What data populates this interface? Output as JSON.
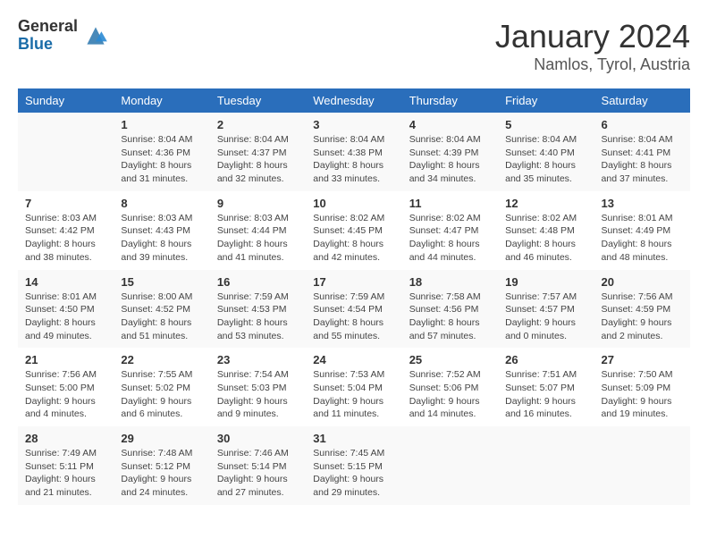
{
  "logo": {
    "general": "General",
    "blue": "Blue"
  },
  "title": "January 2024",
  "subtitle": "Namlos, Tyrol, Austria",
  "days_header": [
    "Sunday",
    "Monday",
    "Tuesday",
    "Wednesday",
    "Thursday",
    "Friday",
    "Saturday"
  ],
  "weeks": [
    [
      {
        "day": "",
        "info": ""
      },
      {
        "day": "1",
        "info": "Sunrise: 8:04 AM\nSunset: 4:36 PM\nDaylight: 8 hours\nand 31 minutes."
      },
      {
        "day": "2",
        "info": "Sunrise: 8:04 AM\nSunset: 4:37 PM\nDaylight: 8 hours\nand 32 minutes."
      },
      {
        "day": "3",
        "info": "Sunrise: 8:04 AM\nSunset: 4:38 PM\nDaylight: 8 hours\nand 33 minutes."
      },
      {
        "day": "4",
        "info": "Sunrise: 8:04 AM\nSunset: 4:39 PM\nDaylight: 8 hours\nand 34 minutes."
      },
      {
        "day": "5",
        "info": "Sunrise: 8:04 AM\nSunset: 4:40 PM\nDaylight: 8 hours\nand 35 minutes."
      },
      {
        "day": "6",
        "info": "Sunrise: 8:04 AM\nSunset: 4:41 PM\nDaylight: 8 hours\nand 37 minutes."
      }
    ],
    [
      {
        "day": "7",
        "info": "Sunrise: 8:03 AM\nSunset: 4:42 PM\nDaylight: 8 hours\nand 38 minutes."
      },
      {
        "day": "8",
        "info": "Sunrise: 8:03 AM\nSunset: 4:43 PM\nDaylight: 8 hours\nand 39 minutes."
      },
      {
        "day": "9",
        "info": "Sunrise: 8:03 AM\nSunset: 4:44 PM\nDaylight: 8 hours\nand 41 minutes."
      },
      {
        "day": "10",
        "info": "Sunrise: 8:02 AM\nSunset: 4:45 PM\nDaylight: 8 hours\nand 42 minutes."
      },
      {
        "day": "11",
        "info": "Sunrise: 8:02 AM\nSunset: 4:47 PM\nDaylight: 8 hours\nand 44 minutes."
      },
      {
        "day": "12",
        "info": "Sunrise: 8:02 AM\nSunset: 4:48 PM\nDaylight: 8 hours\nand 46 minutes."
      },
      {
        "day": "13",
        "info": "Sunrise: 8:01 AM\nSunset: 4:49 PM\nDaylight: 8 hours\nand 48 minutes."
      }
    ],
    [
      {
        "day": "14",
        "info": "Sunrise: 8:01 AM\nSunset: 4:50 PM\nDaylight: 8 hours\nand 49 minutes."
      },
      {
        "day": "15",
        "info": "Sunrise: 8:00 AM\nSunset: 4:52 PM\nDaylight: 8 hours\nand 51 minutes."
      },
      {
        "day": "16",
        "info": "Sunrise: 7:59 AM\nSunset: 4:53 PM\nDaylight: 8 hours\nand 53 minutes."
      },
      {
        "day": "17",
        "info": "Sunrise: 7:59 AM\nSunset: 4:54 PM\nDaylight: 8 hours\nand 55 minutes."
      },
      {
        "day": "18",
        "info": "Sunrise: 7:58 AM\nSunset: 4:56 PM\nDaylight: 8 hours\nand 57 minutes."
      },
      {
        "day": "19",
        "info": "Sunrise: 7:57 AM\nSunset: 4:57 PM\nDaylight: 9 hours\nand 0 minutes."
      },
      {
        "day": "20",
        "info": "Sunrise: 7:56 AM\nSunset: 4:59 PM\nDaylight: 9 hours\nand 2 minutes."
      }
    ],
    [
      {
        "day": "21",
        "info": "Sunrise: 7:56 AM\nSunset: 5:00 PM\nDaylight: 9 hours\nand 4 minutes."
      },
      {
        "day": "22",
        "info": "Sunrise: 7:55 AM\nSunset: 5:02 PM\nDaylight: 9 hours\nand 6 minutes."
      },
      {
        "day": "23",
        "info": "Sunrise: 7:54 AM\nSunset: 5:03 PM\nDaylight: 9 hours\nand 9 minutes."
      },
      {
        "day": "24",
        "info": "Sunrise: 7:53 AM\nSunset: 5:04 PM\nDaylight: 9 hours\nand 11 minutes."
      },
      {
        "day": "25",
        "info": "Sunrise: 7:52 AM\nSunset: 5:06 PM\nDaylight: 9 hours\nand 14 minutes."
      },
      {
        "day": "26",
        "info": "Sunrise: 7:51 AM\nSunset: 5:07 PM\nDaylight: 9 hours\nand 16 minutes."
      },
      {
        "day": "27",
        "info": "Sunrise: 7:50 AM\nSunset: 5:09 PM\nDaylight: 9 hours\nand 19 minutes."
      }
    ],
    [
      {
        "day": "28",
        "info": "Sunrise: 7:49 AM\nSunset: 5:11 PM\nDaylight: 9 hours\nand 21 minutes."
      },
      {
        "day": "29",
        "info": "Sunrise: 7:48 AM\nSunset: 5:12 PM\nDaylight: 9 hours\nand 24 minutes."
      },
      {
        "day": "30",
        "info": "Sunrise: 7:46 AM\nSunset: 5:14 PM\nDaylight: 9 hours\nand 27 minutes."
      },
      {
        "day": "31",
        "info": "Sunrise: 7:45 AM\nSunset: 5:15 PM\nDaylight: 9 hours\nand 29 minutes."
      },
      {
        "day": "",
        "info": ""
      },
      {
        "day": "",
        "info": ""
      },
      {
        "day": "",
        "info": ""
      }
    ]
  ]
}
